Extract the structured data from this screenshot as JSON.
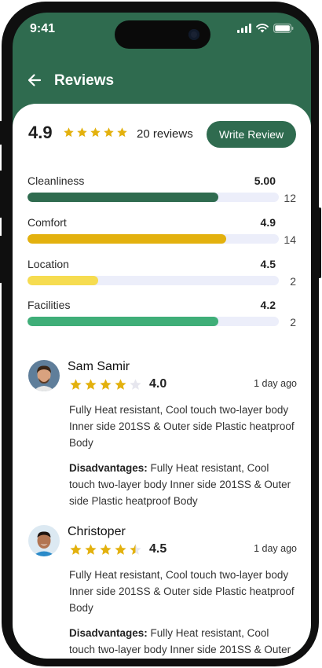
{
  "status_bar": {
    "time": "9:41"
  },
  "header": {
    "title": "Reviews"
  },
  "summary": {
    "average": "4.9",
    "average_stars": 5,
    "review_count_label": "20 reviews",
    "write_review_label": "Write Review"
  },
  "categories": [
    {
      "name": "Cleanliness",
      "score": "5.00",
      "count": "12",
      "fill_fraction": 0.76,
      "color": "#2f6b4f"
    },
    {
      "name": "Comfort",
      "score": "4.9",
      "count": "14",
      "fill_fraction": 0.79,
      "color": "#e3b10e"
    },
    {
      "name": "Location",
      "score": "4.5",
      "count": "2",
      "fill_fraction": 0.28,
      "color": "#f6dc50"
    },
    {
      "name": "Facilities",
      "score": "4.2",
      "count": "2",
      "fill_fraction": 0.76,
      "color": "#3fae78"
    }
  ],
  "colors": {
    "brand_green": "#2f6b4f",
    "star_gold": "#e3b10e",
    "star_empty": "#e6e6ee",
    "track": "#eceefa"
  },
  "reviews": [
    {
      "name": "Sam Samir",
      "rating": "4.0",
      "stars": 4,
      "date": "1 day ago",
      "text": "Fully Heat resistant, Cool touch two-layer body   Inner side 201SS & Outer side Plastic heatproof Body",
      "disadvantages_label": "Disadvantages:",
      "disadvantages_text": " Fully Heat resistant, Cool touch two-layer body   Inner side 201SS & Outer side Plastic heatproof Body"
    },
    {
      "name": "Christoper",
      "rating": "4.5",
      "stars": 4.5,
      "date": "1 day ago",
      "text": "Fully Heat resistant, Cool touch two-layer body   Inner side 201SS & Outer side Plastic heatproof Body",
      "disadvantages_label": "Disadvantages:",
      "disadvantages_text": " Fully Heat resistant, Cool touch two-layer body   Inner side 201SS & Outer side Plastic heatproof Body"
    }
  ]
}
